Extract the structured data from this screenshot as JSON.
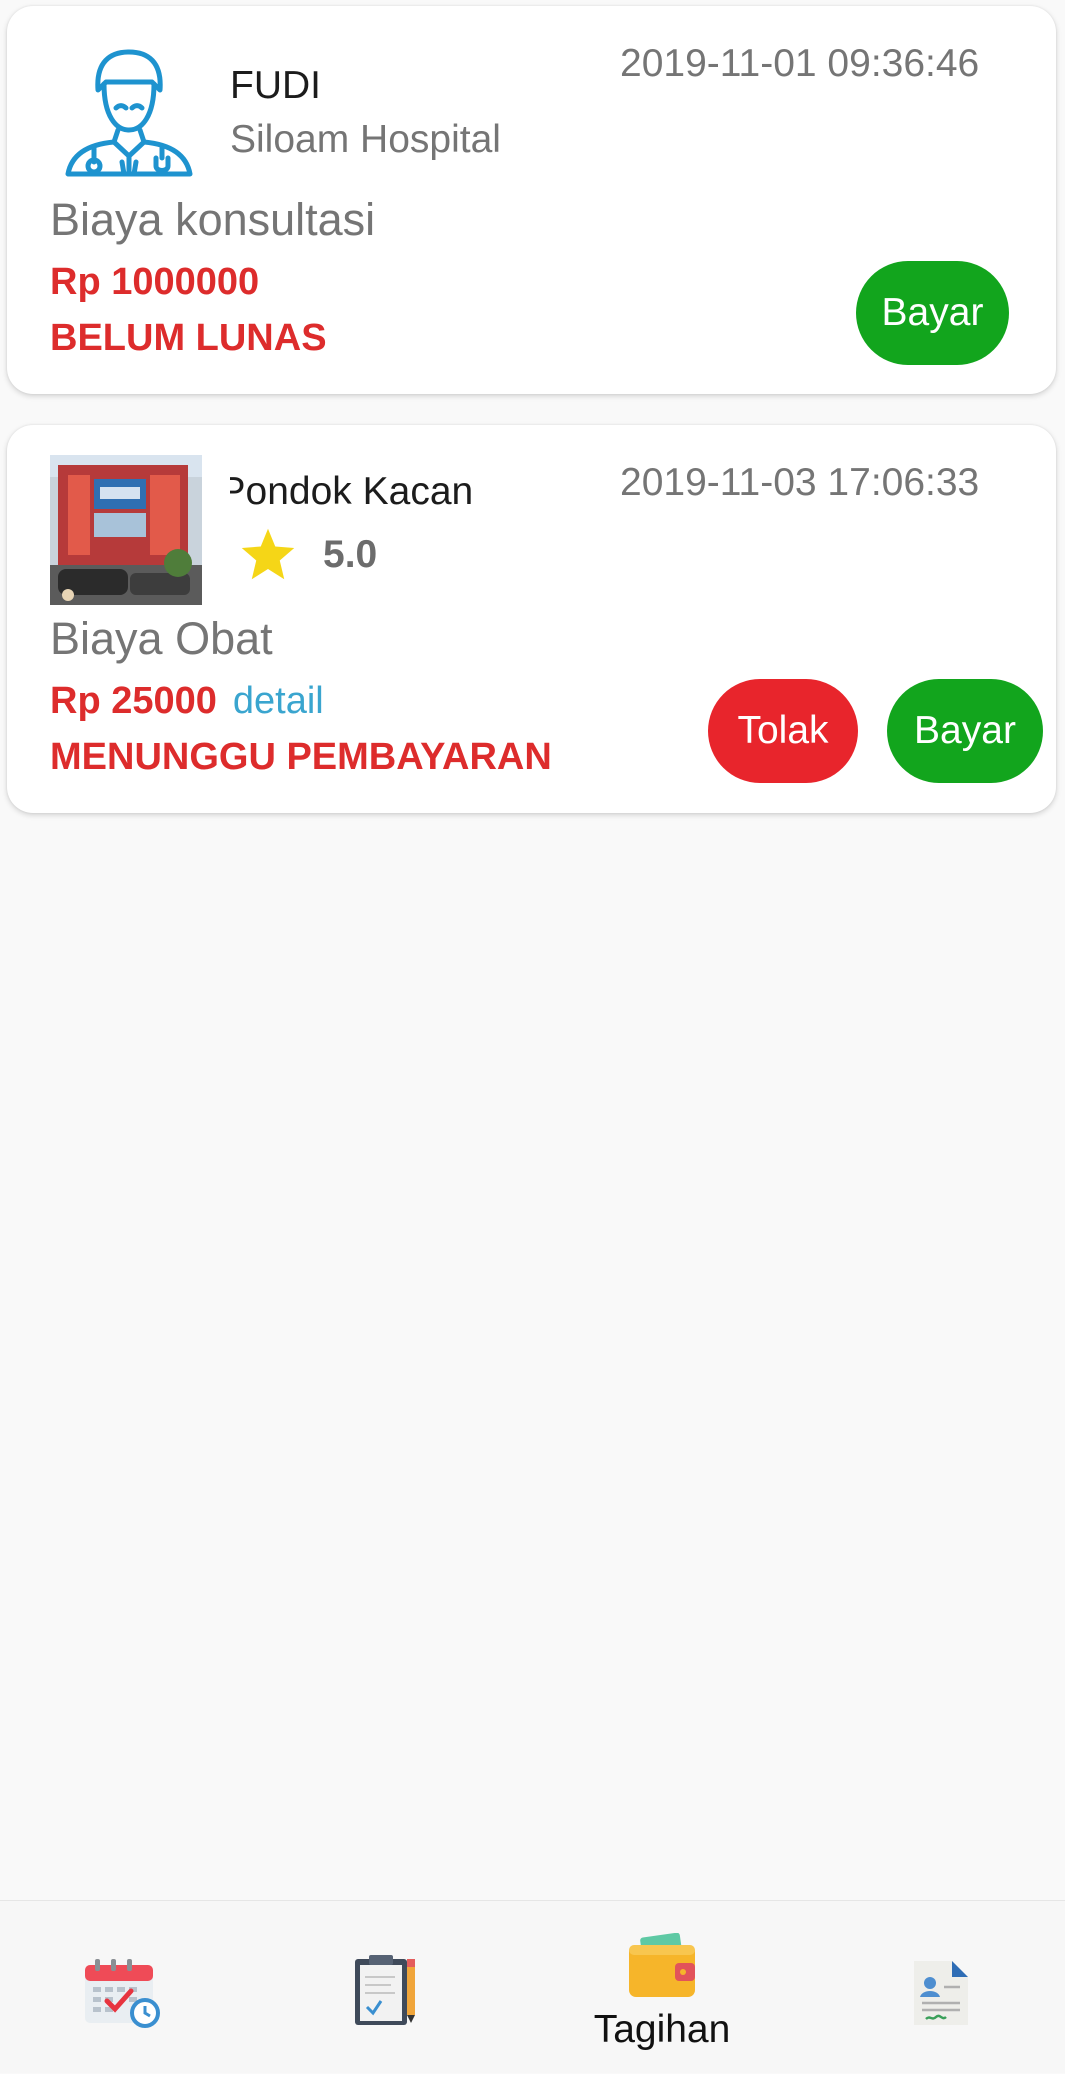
{
  "bills": [
    {
      "provider_name": "FUDI",
      "provider_subtitle": "Siloam Hospital",
      "timestamp": "2019-11-01 09:36:46",
      "title": "Biaya konsultasi",
      "amount": "Rp 1000000",
      "status": "BELUM LUNAS",
      "pay_label": "Bayar",
      "icon": "doctor-icon"
    },
    {
      "provider_name": "Mayapada Hospital Century Pondok Kacang",
      "provider_name_visible": "ntury Pondok Kacan",
      "timestamp": "2019-11-03 17:06:33",
      "rating": "5.0",
      "title": "Biaya Obat",
      "amount": "Rp 25000",
      "detail_label": "detail",
      "status": "MENUNGGU PEMBAYARAN",
      "reject_label": "Tolak",
      "pay_label": "Bayar",
      "icon": "hospital-photo"
    }
  ],
  "bottom_nav": {
    "items": [
      {
        "id": "schedule",
        "icon": "calendar-icon",
        "label": ""
      },
      {
        "id": "records",
        "icon": "clipboard-icon",
        "label": ""
      },
      {
        "id": "bills",
        "icon": "wallet-icon",
        "label": "Tagihan",
        "active": true
      },
      {
        "id": "profile",
        "icon": "document-profile-icon",
        "label": ""
      }
    ]
  },
  "colors": {
    "danger": "#dd2c2c",
    "pay_green": "#12a51d",
    "reject_red": "#e8252c",
    "link": "#3aa5cf",
    "muted_text": "#757575",
    "doctor_icon": "#1e93cf",
    "star": "#f5d617"
  }
}
